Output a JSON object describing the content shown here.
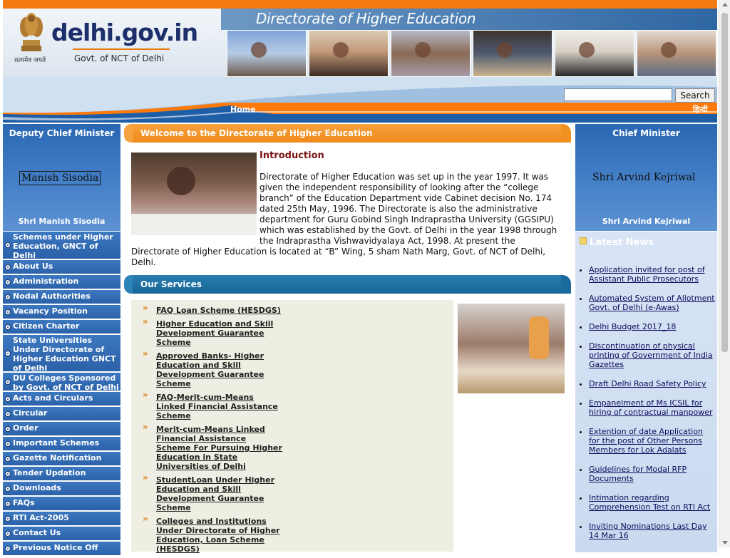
{
  "header": {
    "site_logo": "delhi.gov.in",
    "site_subtitle": "Govt. of NCT of Delhi",
    "emblem_motto": "सत्यमेव जयते",
    "department_title": "Directorate of Higher Education",
    "search": {
      "value": "",
      "button_label": "Search"
    },
    "home_link": "Home",
    "hindi_link": "हिन्दी",
    "photo_icons": [
      "graduates-photo",
      "students-photo",
      "classroom-photo",
      "graduation-photo",
      "graduate-woman-photo",
      "study-group-photo"
    ]
  },
  "left": {
    "minister_title": "Deputy Chief Minister",
    "minister_photo_alt": "Manish Sisodia",
    "minister_name": "Shri Manish Sisodia",
    "nav": [
      "Schemes under Higher Education, GNCT of Delhi",
      "About Us",
      "Administration",
      "Nodal Authorities",
      "Vacancy Position",
      "Citizen Charter",
      "State Universities Under Directorate of Higher Education GNCT of Delhi",
      "DU Colleges Sponsored by Govt. of NCT of Delhi",
      "Acts and Circulars",
      "Circular",
      "Order",
      "Important Schemes",
      "Gazette Notification",
      "Tender Updation",
      "Downloads",
      "FAQs",
      "RTI Act-2005",
      "Contact Us",
      "Previous Notice Off"
    ]
  },
  "center": {
    "welcome_bar": "Welcome to the Directorate of Higher Education",
    "intro_heading": "Introduction",
    "intro_text": "Directorate of Higher Education was set up in the year 1997. It was given the independent responsibility of looking after the “college branch” of the Education Department vide Cabinet decision No. 174 dated 25th May, 1996. The Directorate is also the administrative department for Guru Gobind Singh Indraprastha University (GGSIPU) which was established by the Govt. of Delhi in the year 1998 through the Indraprastha Vishwavidyalaya Act, 1998. At present the Directorate of Higher Education is located at “B” Wing, 5 sham Nath Marg, Govt. of NCT of Delhi, Delhi.",
    "services_bar": "Our Services",
    "services": [
      "FAQ Loan Scheme (HESDGS)",
      "Higher Education and Skill Development Guarantee Scheme",
      "Approved Banks- Higher Education and Skill Development Guarantee Scheme",
      "FAQ-Merit-cum-Means Linked Financial Assistance Scheme",
      "Merit-cum-Means Linked Financial Assistance Scheme For Pursuing Higher Education in State Universities of Delhi",
      "StudentLoan Under Higher Education and Skill Development Guarantee Scheme",
      "Colleges and Institutions Under Directorate of Higher Education, Loan Scheme (HESDGS)"
    ]
  },
  "right": {
    "cm_title": "Chief Minister",
    "cm_photo_alt": "Shri Arvind Kejriwal",
    "cm_name": "Shri Arvind Kejriwal",
    "news_title": "Latest News",
    "news": [
      "Application invited for post of Assistant Public Prosecutors",
      "Automated System of Allotment Govt. of Delhi (e-Awas)",
      "Delhi Budget 2017_18",
      "Discontinuation of physical printing of Government of India Gazettes",
      "Draft Delhi Road Safety Policy",
      "Empanelment of Ms ICSIL for hiring of contractual manpower",
      "Extention of date Application for the post of Other Persons Members for Lok Adalats",
      "Guidelines for Modal RFP Documents",
      "Intimation regarding Comprehension Test on RTI Act",
      "Inviting Nominations Last Day 14 Mar 16"
    ]
  },
  "colors": {
    "accent_orange": "#f47a12",
    "nav_blue": "#2b61a8",
    "services_blue": "#176596",
    "intro_heading": "#7a1111",
    "news_bg": "#cbdaf0"
  }
}
